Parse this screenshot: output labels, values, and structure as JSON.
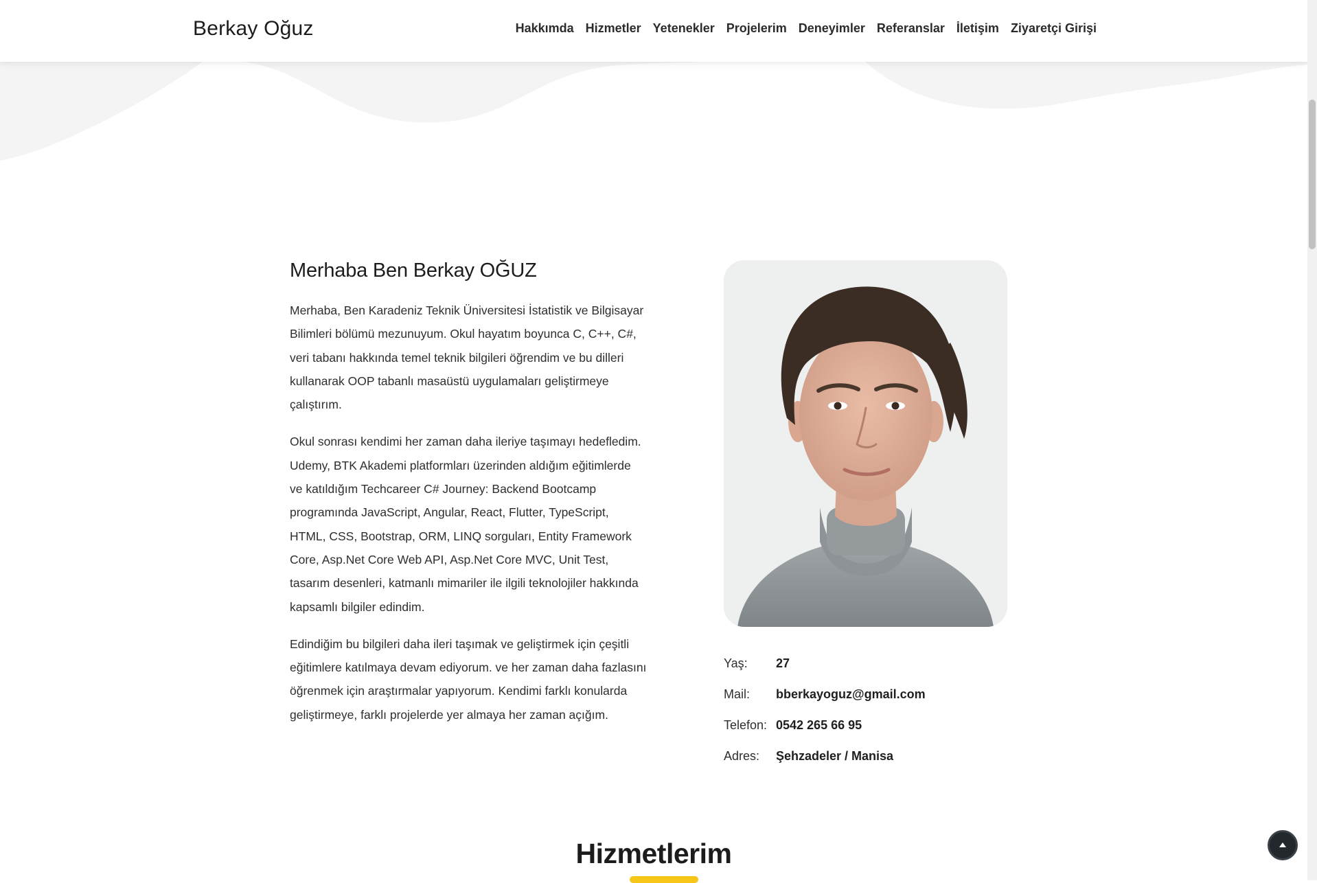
{
  "brand": {
    "name": "Berkay Oğuz"
  },
  "nav": {
    "items": [
      {
        "label": "Hakkımda"
      },
      {
        "label": "Hizmetler"
      },
      {
        "label": "Yetenekler"
      },
      {
        "label": "Projelerim"
      },
      {
        "label": "Deneyimler"
      },
      {
        "label": "Referanslar"
      },
      {
        "label": "İletişim"
      },
      {
        "label": "Ziyaretçi Girişi"
      }
    ]
  },
  "about": {
    "title": "Merhaba Ben Berkay OĞUZ",
    "paragraphs": [
      "Merhaba, Ben Karadeniz Teknik Üniversitesi İstatistik ve Bilgisayar Bilimleri bölümü mezunuyum. Okul hayatım boyunca C, C++, C#, veri tabanı hakkında temel teknik bilgileri öğrendim ve bu dilleri kullanarak OOP tabanlı masaüstü uygulamaları geliştirmeye çalıştırım.",
      "Okul sonrası kendimi her zaman daha ileriye taşımayı hedefledim. Udemy, BTK Akademi platformları üzerinden aldığım eğitimlerde ve katıldığım Techcareer C# Journey: Backend Bootcamp programında JavaScript, Angular, React, Flutter, TypeScript, HTML, CSS, Bootstrap, ORM, LINQ sorguları, Entity Framework Core, Asp.Net Core Web API, Asp.Net Core MVC, Unit Test, tasarım desenleri, katmanlı mimariler ile ilgili teknolojiler hakkında kapsamlı bilgiler edindim.",
      "Edindiğim bu bilgileri daha ileri taşımak ve geliştirmek için çeşitli eğitimlere katılmaya devam ediyorum. ve her zaman daha fazlasını öğrenmek için araştırmalar yapıyorum. Kendimi farklı konularda geliştirmeye, farklı projelerde yer almaya her zaman açığım."
    ],
    "info": [
      {
        "label": "Yaş:",
        "value": "27"
      },
      {
        "label": "Mail:",
        "value": "bberkayoguz@gmail.com"
      },
      {
        "label": "Telefon:",
        "value": "0542 265 66 95"
      },
      {
        "label": "Adres:",
        "value": "Şehzadeler / Manisa"
      }
    ]
  },
  "services": {
    "title": "Hizmetlerim"
  },
  "colors": {
    "accent": "#f5c518",
    "wave": "#f4f4f5",
    "dark": "#23282d"
  },
  "icons": {
    "scroll_top": "arrow-up-icon"
  }
}
